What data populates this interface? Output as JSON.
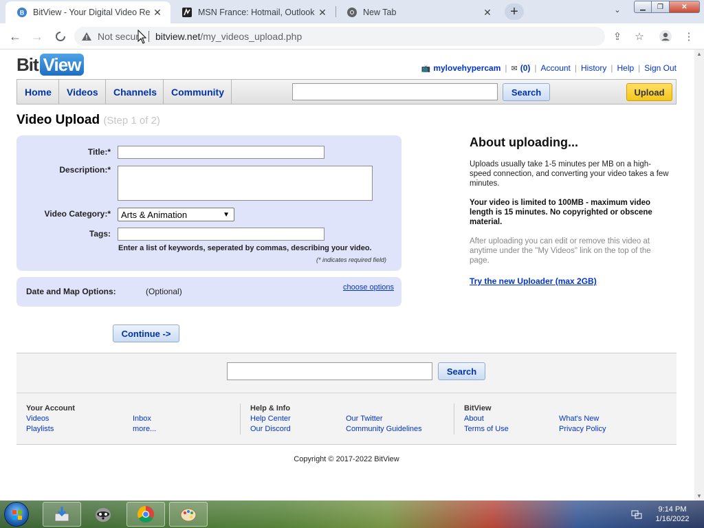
{
  "browser": {
    "tabs": [
      {
        "title": "BitView - Your Digital Video Repository",
        "active": true
      },
      {
        "title": "MSN France: Hotmail, Outlook, actualités",
        "active": false
      },
      {
        "title": "New Tab",
        "active": false
      }
    ],
    "address": {
      "security_label": "Not secure",
      "host": "bitview.net",
      "path": "/my_videos_upload.php"
    }
  },
  "site": {
    "logo_left": "Bit",
    "logo_right": "View",
    "user": {
      "username": "mylovehypercam",
      "inbox_count": "(0)",
      "links": [
        "Account",
        "History",
        "Help",
        "Sign Out"
      ]
    },
    "nav": {
      "items": [
        "Home",
        "Videos",
        "Channels",
        "Community"
      ],
      "search_button": "Search",
      "upload_button": "Upload"
    }
  },
  "upload": {
    "title": "Video Upload",
    "step": "(Step 1 of 2)",
    "fields": {
      "title_label": "Title:*",
      "description_label": "Description:*",
      "category_label": "Video Category:*",
      "category_value": "Arts & Animation",
      "tags_label": "Tags:",
      "tags_hint": "Enter a list of keywords, seperated by commas, describing your video.",
      "required_note": "(* indicates required field)"
    },
    "date_map": {
      "label": "Date and Map Options:",
      "optional": "(Optional)",
      "link": "choose options"
    },
    "continue_button": "Continue ->"
  },
  "about": {
    "heading": "About uploading...",
    "p1": "Uploads usually take 1-5 minutes per MB on a high-speed connection, and converting your video takes a few minutes.",
    "p2": "Your video is limited to 100MB - maximum video length is 15 minutes. No copyrighted or obscene material.",
    "p3": "After uploading you can edit or remove this video at anytime under the \"My Videos\" link on the top of the page.",
    "link": "Try the new Uploader (max 2GB)"
  },
  "footer": {
    "search_button": "Search",
    "columns": [
      {
        "heading": "Your Account",
        "links": [
          "Videos",
          "Playlists",
          "Inbox",
          "more..."
        ]
      },
      {
        "heading": "Help & Info",
        "links": [
          "Help Center",
          "Our Discord",
          "Our Twitter",
          "Community Guidelines"
        ]
      },
      {
        "heading": "BitView",
        "links": [
          "About",
          "Terms of Use",
          "What's New",
          "Privacy Policy"
        ]
      }
    ],
    "copyright": "Copyright © 2017-2022 BitView"
  },
  "taskbar": {
    "time": "9:14 PM",
    "date": "1/16/2022"
  }
}
